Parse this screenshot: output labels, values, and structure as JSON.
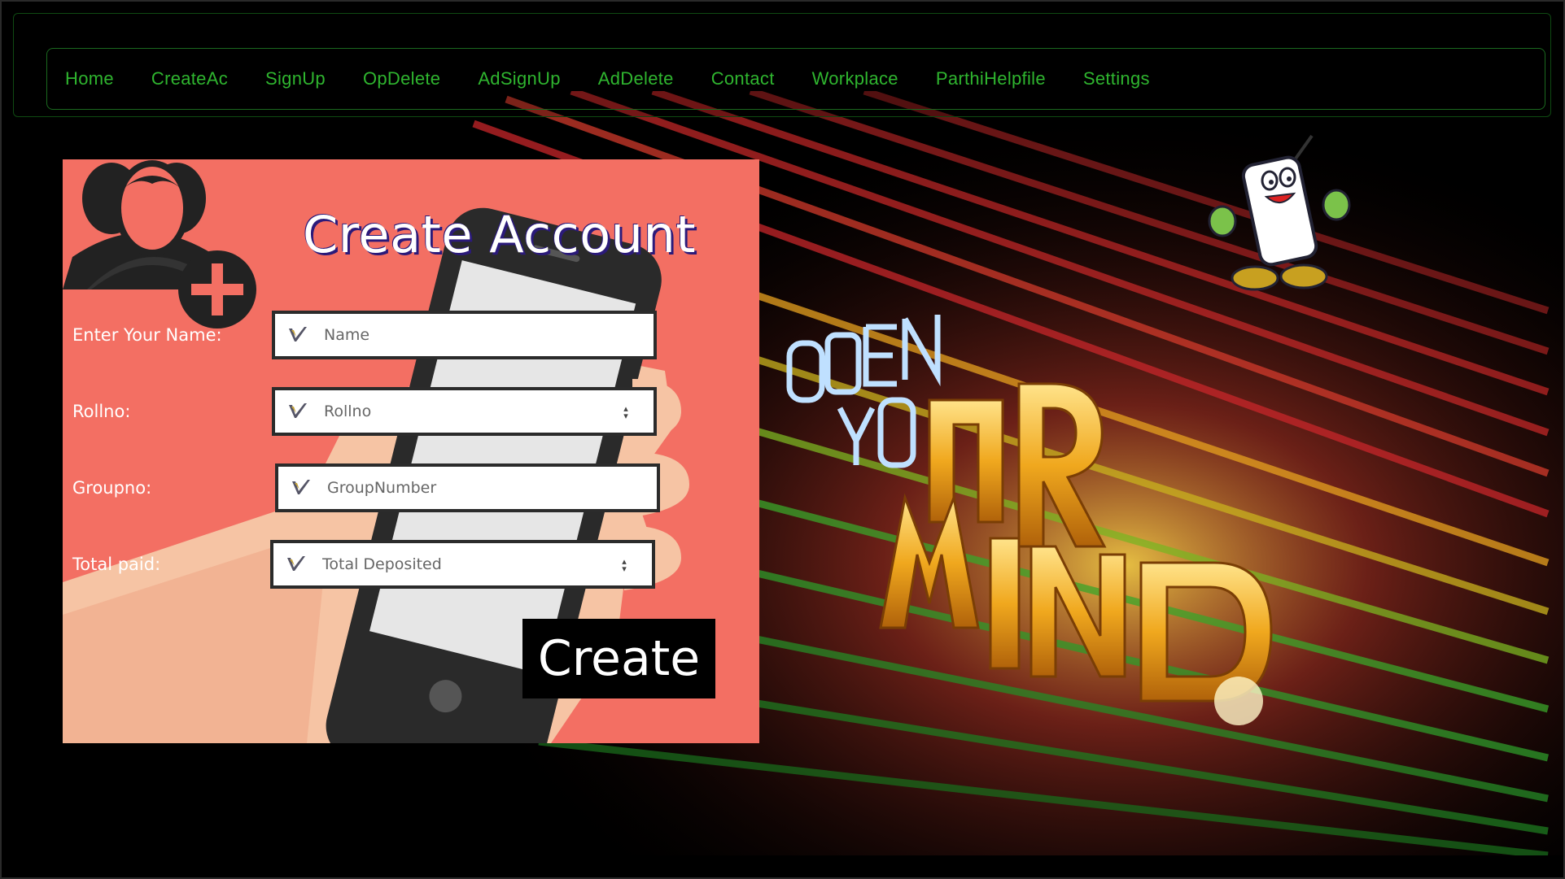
{
  "nav": {
    "items": [
      "Home",
      "CreateAc",
      "SignUp",
      "OpDelete",
      "AdSignUp",
      "AdDelete",
      "Contact",
      "Workplace",
      "ParthiHelpfile",
      "Settings"
    ]
  },
  "form": {
    "title": "Create Account",
    "fields": [
      {
        "label": "Enter Your Name:",
        "placeholder": "Name",
        "type": "text"
      },
      {
        "label": "Rollno:",
        "placeholder": "Rollno",
        "type": "number"
      },
      {
        "label": "Groupno:",
        "placeholder": "GroupNumber",
        "type": "text"
      },
      {
        "label": "Total paid:",
        "placeholder": "Total Deposited",
        "type": "number"
      }
    ],
    "submit_label": "Create"
  },
  "colors": {
    "background": "#000000",
    "nav_text": "#2fb52f",
    "card": "#f36f63",
    "title_shadow": "#2b1a7a",
    "button": "#000000"
  },
  "icons": [
    "user-add-icon",
    "pen-icon",
    "mascot-phone-image",
    "open-your-mind-wordart"
  ]
}
